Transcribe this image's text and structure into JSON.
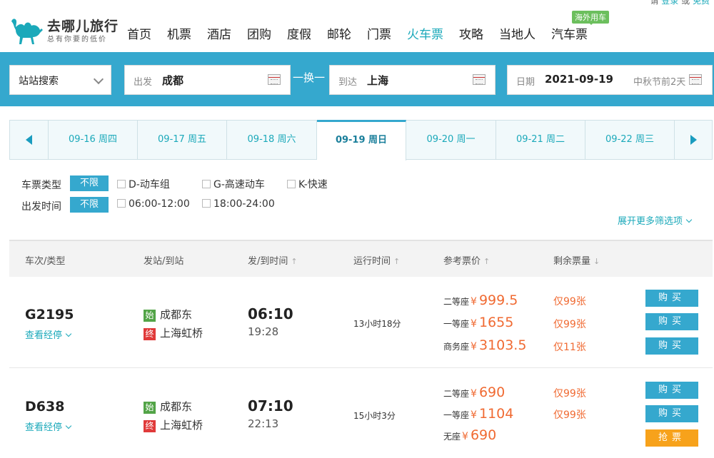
{
  "header": {
    "login_hint_prefix": "请",
    "login_link": "登录",
    "login_or": "或",
    "register_link": "免费",
    "logo_title": "去哪儿旅行",
    "logo_sub": "总有你要的低价",
    "nav": [
      "首页",
      "机票",
      "酒店",
      "团购",
      "度假",
      "邮轮",
      "门票",
      "火车票",
      "攻略",
      "当地人",
      "汽车票"
    ],
    "nav_active": "火车票",
    "nav_badge": "海外用车"
  },
  "search": {
    "mode_value": "站站搜索",
    "from_label": "出发",
    "from_value": "成都",
    "swap_label": "一换一",
    "to_label": "到达",
    "to_value": "上海",
    "date_label": "日期",
    "date_value": "2021-09-19",
    "date_note": "中秋节前2天"
  },
  "date_tabs": [
    "09-16 周四",
    "09-17 周五",
    "09-18 周六",
    "09-19 周日",
    "09-20 周一",
    "09-21 周二",
    "09-22 周三"
  ],
  "date_tab_active": "09-19 周日",
  "filters": {
    "type_label": "车票类型",
    "time_label": "出发时间",
    "unlimited": "不限",
    "type_options": [
      "D-动车组",
      "G-高速动车",
      "K-快速"
    ],
    "time_options": [
      "06:00-12:00",
      "18:00-24:00"
    ],
    "more": "展开更多筛选项"
  },
  "table": {
    "headers": [
      "车次/类型",
      "发站/到站",
      "发/到时间",
      "运行时间",
      "参考票价",
      "剩余票量"
    ],
    "stops_label": "查看经停",
    "start_tag": "始",
    "end_tag": "终",
    "yen": "¥",
    "rows": [
      {
        "train": "G2195",
        "from": "成都东",
        "to": "上海虹桥",
        "dep": "06:10",
        "arr": "19:28",
        "duration": "13小时18分",
        "seats": [
          {
            "type": "二等座",
            "price": "999.5",
            "left": "仅99张",
            "action": "购买"
          },
          {
            "type": "一等座",
            "price": "1655",
            "left": "仅99张",
            "action": "购买"
          },
          {
            "type": "商务座",
            "price": "3103.5",
            "left": "仅11张",
            "action": "购买"
          }
        ]
      },
      {
        "train": "D638",
        "from": "成都东",
        "to": "上海虹桥",
        "dep": "07:10",
        "arr": "22:13",
        "duration": "15小时3分",
        "seats": [
          {
            "type": "二等座",
            "price": "690",
            "left": "仅99张",
            "action": "购买"
          },
          {
            "type": "一等座",
            "price": "1104",
            "left": "仅99张",
            "action": "购买"
          },
          {
            "type": "无座",
            "price": "690",
            "left": "",
            "action": "抢票"
          }
        ]
      }
    ]
  },
  "colors": {
    "brand": "#35a8ce",
    "price": "#f06a32",
    "grab": "#f7a21b"
  }
}
